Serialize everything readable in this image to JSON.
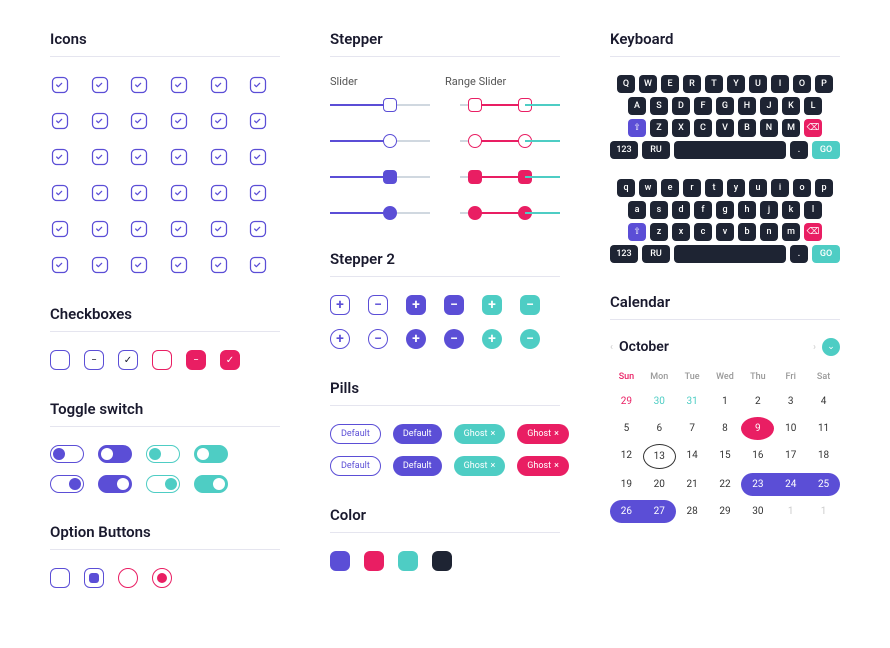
{
  "sections": {
    "icons": "Icons",
    "checkboxes": "Checkboxes",
    "toggle": "Toggle switch",
    "options": "Option Buttons",
    "stepper": "Stepper",
    "slider": "Slider",
    "rangeslider": "Range Slider",
    "stepper2": "Stepper 2",
    "pills": "Pills",
    "color": "Color",
    "keyboard": "Keyboard",
    "calendar": "Calendar"
  },
  "icons_list": [
    "chart-icon",
    "stats-icon",
    "compass-icon",
    "leaf-icon",
    "list-icon",
    "note-icon",
    "play-icon",
    "add-square-icon",
    "moon-icon",
    "emoji-icon",
    "calendar-icon",
    "bag-icon",
    "camera-icon",
    "backpack-icon",
    "document-icon",
    "tv-icon",
    "tag-icon",
    "cube-icon",
    "heart-icon",
    "clock-icon",
    "diamond-icon",
    "eye-icon",
    "user-icon",
    "bookmark-icon",
    "bowl-icon",
    "filter-icon",
    "layers-icon",
    "star-icon",
    "folder-icon",
    "lock-icon",
    "lock-open-icon",
    "shield-icon",
    "mic-icon",
    "video-icon",
    "edit-icon",
    "home-icon",
    "receipt-icon",
    "badge-icon",
    "mail-icon",
    "bell-icon",
    "speaker-icon"
  ],
  "pills": {
    "default": "Default",
    "ghost": "Ghost",
    "close": "×"
  },
  "colors": {
    "purple": "#5b4ed6",
    "pink": "#e91e63",
    "teal": "#4ecdc4",
    "dark": "#1e2433"
  },
  "keyboard": {
    "upper": {
      "r1": [
        "Q",
        "W",
        "E",
        "R",
        "T",
        "Y",
        "U",
        "I",
        "O",
        "P"
      ],
      "r2": [
        "A",
        "S",
        "D",
        "F",
        "G",
        "H",
        "J",
        "K",
        "L"
      ],
      "r3": [
        "⇧",
        "Z",
        "X",
        "C",
        "V",
        "B",
        "N",
        "M",
        "⌫"
      ],
      "r4": [
        "123",
        "RU",
        "",
        ".",
        "GO"
      ]
    },
    "lower": {
      "r1": [
        "q",
        "w",
        "e",
        "r",
        "t",
        "y",
        "u",
        "i",
        "o",
        "p"
      ],
      "r2": [
        "a",
        "s",
        "d",
        "f",
        "g",
        "h",
        "j",
        "k",
        "l"
      ],
      "r3": [
        "⇧",
        "z",
        "x",
        "c",
        "v",
        "b",
        "n",
        "m",
        "⌫"
      ],
      "r4": [
        "123",
        "RU",
        "",
        ".",
        "GO"
      ]
    }
  },
  "calendar": {
    "month": "October",
    "dow": [
      "Sun",
      "Mon",
      "Tue",
      "Wed",
      "Thu",
      "Fri",
      "Sat"
    ],
    "days": [
      {
        "n": 29,
        "cls": "other pink"
      },
      {
        "n": 30,
        "cls": "teal"
      },
      {
        "n": 31,
        "cls": "teal"
      },
      {
        "n": 1,
        "cls": ""
      },
      {
        "n": 2,
        "cls": ""
      },
      {
        "n": 3,
        "cls": ""
      },
      {
        "n": 4,
        "cls": ""
      },
      {
        "n": 5,
        "cls": ""
      },
      {
        "n": 6,
        "cls": ""
      },
      {
        "n": 7,
        "cls": ""
      },
      {
        "n": 8,
        "cls": ""
      },
      {
        "n": 9,
        "cls": "sel"
      },
      {
        "n": 10,
        "cls": ""
      },
      {
        "n": 11,
        "cls": ""
      },
      {
        "n": 12,
        "cls": ""
      },
      {
        "n": 13,
        "cls": "circ"
      },
      {
        "n": 14,
        "cls": ""
      },
      {
        "n": 15,
        "cls": ""
      },
      {
        "n": 16,
        "cls": ""
      },
      {
        "n": 17,
        "cls": ""
      },
      {
        "n": 18,
        "cls": ""
      },
      {
        "n": 19,
        "cls": ""
      },
      {
        "n": 20,
        "cls": ""
      },
      {
        "n": 21,
        "cls": ""
      },
      {
        "n": 22,
        "cls": ""
      },
      {
        "n": 23,
        "cls": "range start"
      },
      {
        "n": 24,
        "cls": "range"
      },
      {
        "n": 25,
        "cls": "range end"
      },
      {
        "n": 26,
        "cls": "range start"
      },
      {
        "n": 27,
        "cls": "range end"
      },
      {
        "n": 28,
        "cls": ""
      },
      {
        "n": 29,
        "cls": ""
      },
      {
        "n": 30,
        "cls": ""
      },
      {
        "n": 1,
        "cls": "other"
      },
      {
        "n": 1,
        "cls": "other"
      }
    ]
  }
}
